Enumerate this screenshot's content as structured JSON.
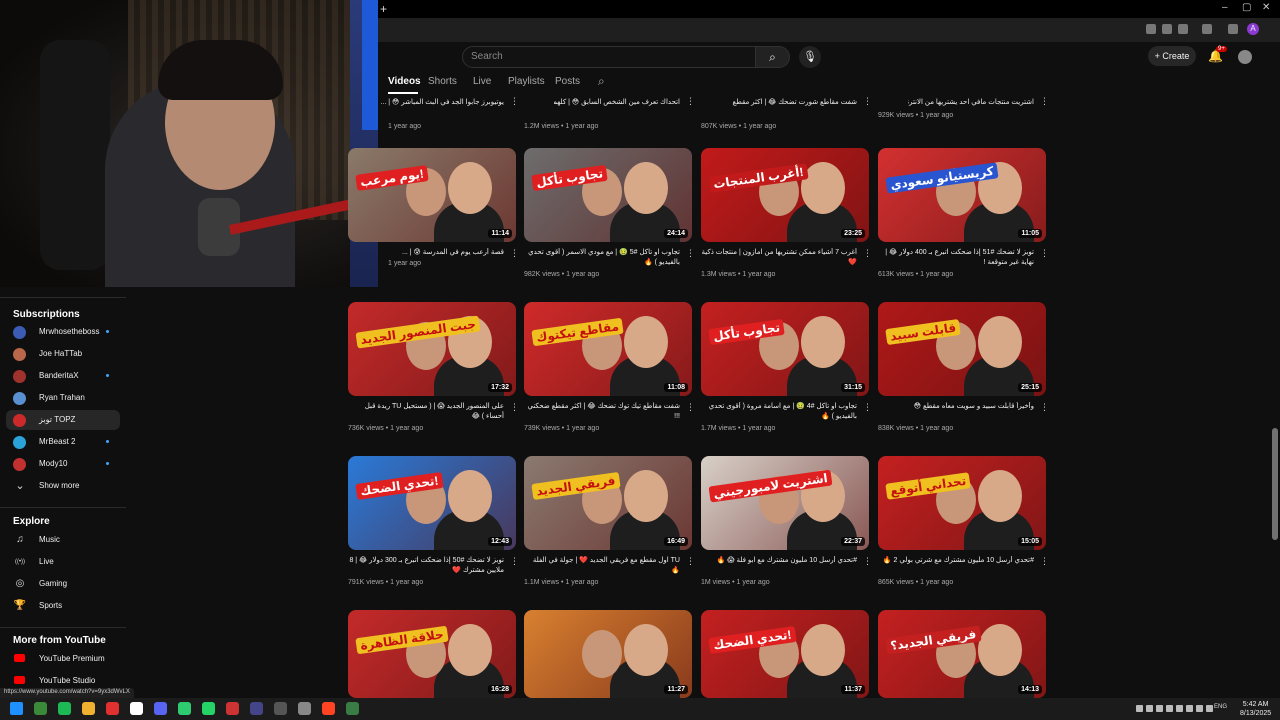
{
  "browser": {
    "new_tab": "+",
    "minimize": "–",
    "maximize": "▢",
    "close": "✕",
    "profile_initial": "A"
  },
  "masthead": {
    "search_placeholder": "Search",
    "create_label": "+ Create",
    "notifications_badge": "9+"
  },
  "channel_tabs": [
    {
      "label": "Videos",
      "active": true
    },
    {
      "label": "Shorts",
      "active": false
    },
    {
      "label": "Live",
      "active": false
    },
    {
      "label": "Playlists",
      "active": false
    },
    {
      "label": "Posts",
      "active": false
    }
  ],
  "sidebar": {
    "subscriptions_title": "Subscriptions",
    "subscriptions": [
      {
        "name": "Mrwhosetheboss",
        "color": "#3b5bb5",
        "dot": true
      },
      {
        "name": "Joe HaTTab",
        "color": "#b9664a",
        "dot": false
      },
      {
        "name": "BanderitaX",
        "color": "#a0322e",
        "dot": true
      },
      {
        "name": "Ryan Trahan",
        "color": "#5a8fd0",
        "dot": false
      },
      {
        "name": "توبز TOPZ",
        "color": "#cc2a2a",
        "dot": false,
        "active": true
      },
      {
        "name": "MrBeast 2",
        "color": "#2aa3d8",
        "dot": true
      },
      {
        "name": "Mody10",
        "color": "#c23030",
        "dot": true
      }
    ],
    "show_more": "Show more",
    "explore_title": "Explore",
    "explore": [
      {
        "name": "Music",
        "icon": "♫"
      },
      {
        "name": "Live",
        "icon": "((•))"
      },
      {
        "name": "Gaming",
        "icon": "◎"
      },
      {
        "name": "Sports",
        "icon": "🏆"
      }
    ],
    "more_title": "More from YouTube",
    "more": [
      {
        "name": "YouTube Premium"
      },
      {
        "name": "YouTube Studio"
      }
    ]
  },
  "top_row": [
    {
      "title": "يوتيوبرز جابوا الجد في البث المباشر 😳 | ...",
      "meta": "1 year ago"
    },
    {
      "title": "اتحداك تعرف مين الشخص السابق 😳 | كلهم كذابين ماعدا شخص واحد !",
      "meta": "1.2M views • 1 year ago"
    },
    {
      "title": "شفت مقاطع شورت تضحك 😂 | اكثر مقطع ضحكت عليه !!! 😂",
      "meta": "807K views • 1 year ago"
    },
    {
      "title": "اشتريت منتجات مافي احد يشتريها من الانترنت ❤️",
      "meta": "929K views • 1 year ago"
    }
  ],
  "videos": [
    {
      "title": "قصة أرعب يوم في المدرسة 😰 | ...",
      "views": "",
      "age": "1 year ago",
      "duration": "11:14",
      "tag": "يوم مرعب!",
      "bg": "#8a7a6a",
      "tagbg": "#e02020"
    },
    {
      "title": "تجاوب او تاكل #5 🤢 | مع مودي الاسمر ( أقوى تحدي بالفيديو ) 🔥",
      "views": "982K views",
      "age": "1 year ago",
      "duration": "24:14",
      "tag": "تجاوب تأكل",
      "bg": "#6d6d6d",
      "tagbg": "#e02020"
    },
    {
      "title": "أغرب 7 أشياء ممكن تشتريها من امازون | منتجات ذكية ❤️",
      "views": "1.3M views",
      "age": "1 year ago",
      "duration": "23:25",
      "tag": "أغرب المنتجات!",
      "bg": "#c21a1a",
      "tagbg": "#c21a1a"
    },
    {
      "title": "توبز لا تضحك #51 إذا ضحكت اتبرع بـ 400 دولار 😂 | نهاية غير متوقعة !",
      "views": "613K views",
      "age": "1 year ago",
      "duration": "11:05",
      "tag": "كريستيانو سعودي",
      "bg": "#d33030",
      "tagbg": "#2a55d0"
    },
    {
      "title": "على المنصور الجديد 😱 | ( مستحيل TU ريدة قبل أحساء ) 😂",
      "views": "736K views",
      "age": "1 year ago",
      "duration": "17:32",
      "tag": "جبت المنصور الجديد",
      "bg": "#c42a2a",
      "tagbg": "#f0c020"
    },
    {
      "title": "شفت مقاطع تيك توك تضحك 😂 | اكثر مقطع ضحكني !!!",
      "views": "739K views",
      "age": "1 year ago",
      "duration": "11:08",
      "tag": "مقاطع تيكتوك",
      "bg": "#d02a2a",
      "tagbg": "#f0c020"
    },
    {
      "title": "تجاوب او تاكل #4 🤢 | مع اسامة مروة ( أقوى تحدي بالفيديو ) 🔥",
      "views": "1.7M views",
      "age": "1 year ago",
      "duration": "31:15",
      "tag": "تجاوب تأكل",
      "bg": "#c42020",
      "tagbg": "#e02020"
    },
    {
      "title": "وأخيراً قابلت سبيد و سويت معاه مقطع 😳",
      "views": "838K views",
      "age": "1 year ago",
      "duration": "25:15",
      "tag": "قابلت سبيد",
      "bg": "#b01818",
      "tagbg": "#f0c020"
    },
    {
      "title": "توبز لا تضحك #50 إذا ضحكت اتبرع بـ 300 دولار 😂 | 8 ملايين مشترك ❤️",
      "views": "791K views",
      "age": "1 year ago",
      "duration": "12:43",
      "tag": "تحدي الضحك!",
      "bg": "#2a7ad8",
      "tagbg": "#e02020"
    },
    {
      "title": "TU اول مقطع مع فريقي الجديد ❤️ | جولة في الفلة 🔥",
      "views": "1.1M views",
      "age": "1 year ago",
      "duration": "16:49",
      "tag": "فريقي الجديد",
      "bg": "#8a7a70",
      "tagbg": "#f0c020"
    },
    {
      "title": "#تحدي أرسل 10 مليون مشترك مع ابو فلة 😱 🔥",
      "views": "1M views",
      "age": "1 year ago",
      "duration": "22:37",
      "tag": "اشتريت لامبورجيني",
      "bg": "#d8d0c8",
      "tagbg": "#e02020"
    },
    {
      "title": "#تحدي أرسل 10 مليون مشترك مع شرتي بولي 2 🔥",
      "views": "865K views",
      "age": "1 year ago",
      "duration": "15:05",
      "tag": "تحداني أتوقع",
      "bg": "#c42020",
      "tagbg": "#f0c020"
    },
    {
      "title": "",
      "views": "",
      "age": "",
      "duration": "16:28",
      "tag": "حلاقة الظاهرة",
      "bg": "#c42a2a",
      "tagbg": "#f0c020"
    },
    {
      "title": "",
      "views": "",
      "age": "",
      "duration": "11:27",
      "tag": "",
      "bg": "#d88030",
      "tagbg": "#e02020"
    },
    {
      "title": "",
      "views": "",
      "age": "",
      "duration": "11:37",
      "tag": "تحدي الضحك!",
      "bg": "#c42020",
      "tagbg": "#e02020"
    },
    {
      "title": "",
      "views": "",
      "age": "",
      "duration": "14:13",
      "tag": "فريقي الجديد؟",
      "bg": "#c42020",
      "tagbg": "#c42020"
    }
  ],
  "status_url": "https://www.youtube.com/watch?v=9yx3dWvLX",
  "taskbar": {
    "time": "5:42 AM",
    "date": "8/13/2025",
    "lang": "ENG"
  }
}
